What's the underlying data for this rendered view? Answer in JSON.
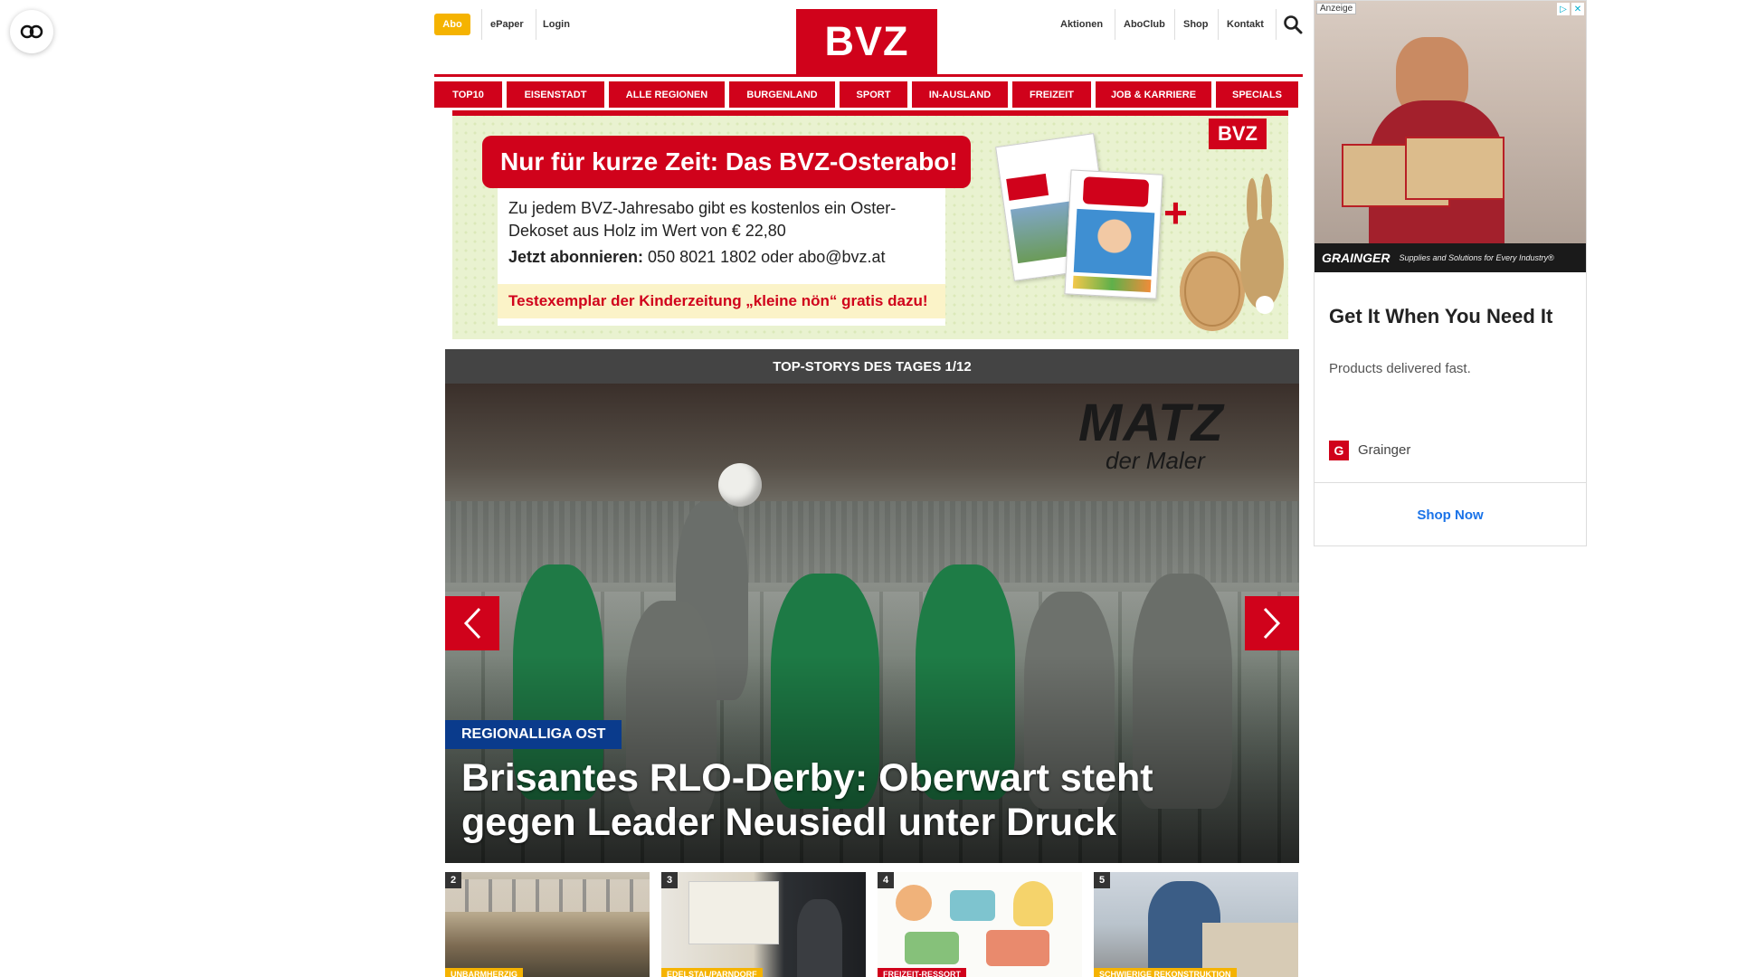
{
  "header": {
    "abo_label": "Abo",
    "epaper_label": "ePaper",
    "login_label": "Login",
    "logo_text": "BVZ",
    "right_links": [
      "Aktionen",
      "AboClub",
      "Shop",
      "Kontakt"
    ]
  },
  "nav": {
    "items": [
      "TOP10",
      "EISENSTADT",
      "ALLE REGIONEN",
      "BURGENLAND",
      "SPORT",
      "IN-AUSLAND",
      "FREIZEIT",
      "JOB & KARRIERE",
      "SPECIALS"
    ]
  },
  "promo": {
    "headline": "Nur für kurze Zeit: Das BVZ-Osterabo!",
    "body": "Zu jedem BVZ-Jahresabo gibt es kostenlos ein Oster-Dekoset aus Holz im Wert von € 22,80",
    "cta_bold": "Jetzt abonnieren:",
    "cta_contact": "050 8021 1802 oder abo@bvz.at",
    "footer": "Testexemplar der Kinderzeitung „kleine nön“ gratis dazu!",
    "brand": "BVZ"
  },
  "top_stories": {
    "bar_title": "TOP-STORYS DES TAGES 1/12",
    "hero_sign": "MATZ",
    "hero_sign_sub": "der Maler",
    "hero_tag": "REGIONALLIGA OST",
    "hero_title": "Brisantes RLO-Derby: Oberwart steht gegen Leader Neusiedl unter Druck",
    "thumbnails": [
      {
        "num": "2",
        "tag": "UNBARMHERZIG"
      },
      {
        "num": "3",
        "tag": "EDELSTAL/PARNDORF"
      },
      {
        "num": "4",
        "tag": "FREIZEIT-RESSORT"
      },
      {
        "num": "5",
        "tag": "SCHWIERIGE REKONSTRUKTION"
      }
    ]
  },
  "ad": {
    "label": "Anzeige",
    "brand": "GRAINGER",
    "slogan": "Supplies and Solutions for Every Industry®",
    "title": "Get It When You Need It",
    "description": "Products delivered fast.",
    "advertiser": "Grainger",
    "cta": "Shop Now"
  },
  "colors": {
    "brand_red": "#d0021b",
    "abo_yellow": "#f5b301",
    "tag_blue": "#0a3b8c"
  }
}
